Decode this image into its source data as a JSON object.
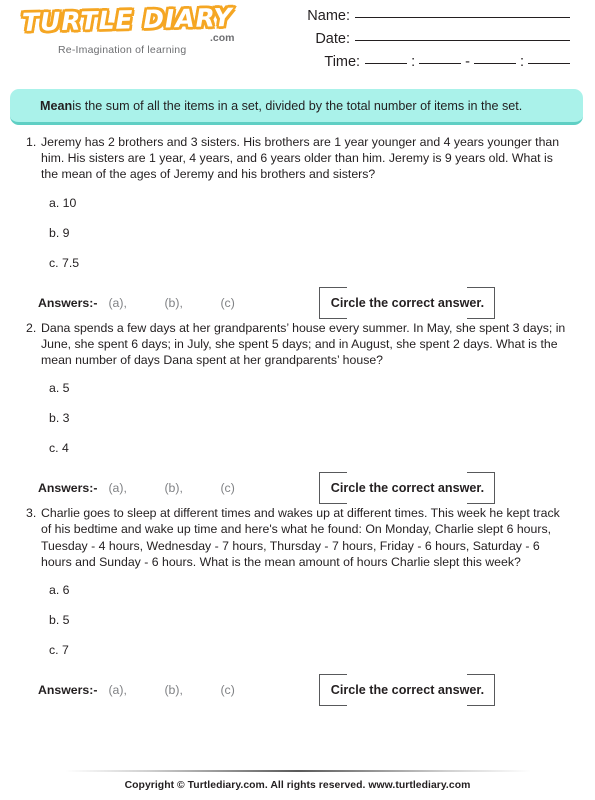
{
  "brand": {
    "logo_text": "TURTLE DIARY",
    "logo_suffix": ".com",
    "tagline": "Re-Imagination of learning",
    "logo_color": "#f5a623"
  },
  "header": {
    "name_label": "Name:",
    "date_label": "Date:",
    "time_label": "Time:",
    "time_colon": ":",
    "time_dash": "-"
  },
  "banner": {
    "term": "Mean",
    "definition": " is the sum of all the items in a set, divided by the total number of items in the set.",
    "background_color": "#aaf2ea"
  },
  "answers_label": "Answers:-",
  "answer_slots": [
    "(a),",
    "(b),",
    "(c)"
  ],
  "circle_box_label": "Circle the correct answer.",
  "questions": [
    {
      "number": "1.",
      "text": "Jeremy has 2 brothers and 3 sisters. His brothers are 1 year younger and 4 years younger than him. His sisters are 1 year, 4 years, and 6 years older than him. Jeremy is 9 years old. What is the mean of the ages of Jeremy and his brothers and sisters?",
      "options": [
        "a. 10",
        "b. 9",
        "c. 7.5"
      ]
    },
    {
      "number": "2.",
      "text": "Dana spends a few days at her grandparents’ house every summer. In May, she spent 3 days; in June, she spent 6 days; in July, she spent 5 days; and in August, she spent 2 days. What is the mean number of days Dana spent at her grandparents’ house?",
      "options": [
        "a. 5",
        "b. 3",
        "c. 4"
      ]
    },
    {
      "number": "3.",
      "text": "Charlie goes to sleep at different times and wakes up at different times. This week he kept track of his bedtime and wake up time and here's what he found: On Monday, Charlie slept  6 hours, Tuesday - 4 hours, Wednesday - 7 hours, Thursday - 7 hours, Friday - 6 hours, Saturday - 6 hours and Sunday - 6 hours. What is the mean amount of hours Charlie slept this week?",
      "options": [
        "a. 6",
        "b. 5",
        "c. 7"
      ]
    }
  ],
  "footer": {
    "text": "Copyright © Turtlediary.com. All rights reserved. www.turtlediary.com"
  }
}
